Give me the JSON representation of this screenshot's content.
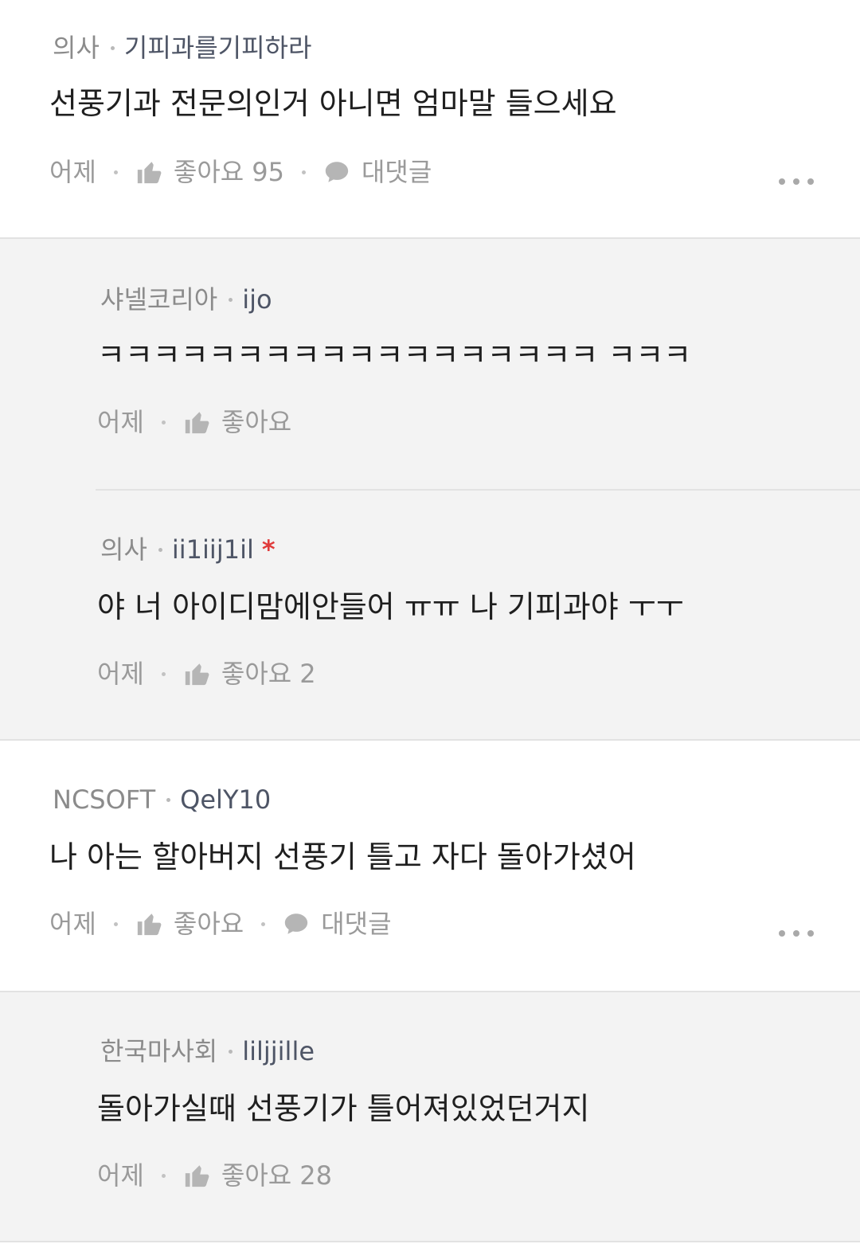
{
  "comments": [
    {
      "author": "의사",
      "nick": "기피과를기피하라",
      "text": "선풍기과 전문의인거 아니면 엄마말 들으세요",
      "time": "어제",
      "like_label": "좋아요",
      "like_count": "95",
      "reply_label": "대댓글"
    },
    {
      "author": "샤넬코리아",
      "nick": "ijo",
      "text": "ㅋㅋㅋㅋㅋㅋㅋㅋㅋㅋㅋㅋㅋㅋㅋㅋㅋㅋ ㅋㅋㅋ",
      "time": "어제",
      "like_label": "좋아요",
      "like_count": ""
    },
    {
      "author": "의사",
      "nick": "ii1iij1il",
      "star": "*",
      "text": "야 너 아이디맘에안들어 ㅠㅠ 나 기피과야 ㅜㅜ",
      "time": "어제",
      "like_label": "좋아요",
      "like_count": "2"
    },
    {
      "author": "NCSOFT",
      "nick": "QelY10",
      "text": "나 아는 할아버지 선풍기 틀고 자다 돌아가셨어",
      "time": "어제",
      "like_label": "좋아요",
      "like_count": "",
      "reply_label": "대댓글"
    },
    {
      "author": "한국마사회",
      "nick": "liljjille",
      "text": "돌아가실때 선풍기가 틀어져있었던거지",
      "time": "어제",
      "like_label": "좋아요",
      "like_count": "28"
    }
  ],
  "icons": {
    "like": "thumbs-up-icon",
    "reply": "speech-bubble-icon",
    "more": "more-dots-icon"
  },
  "colors": {
    "reply_bg": "#f3f3f3",
    "author": "#8b8b8b",
    "nick": "#4e5566",
    "star": "#e03c3c"
  }
}
